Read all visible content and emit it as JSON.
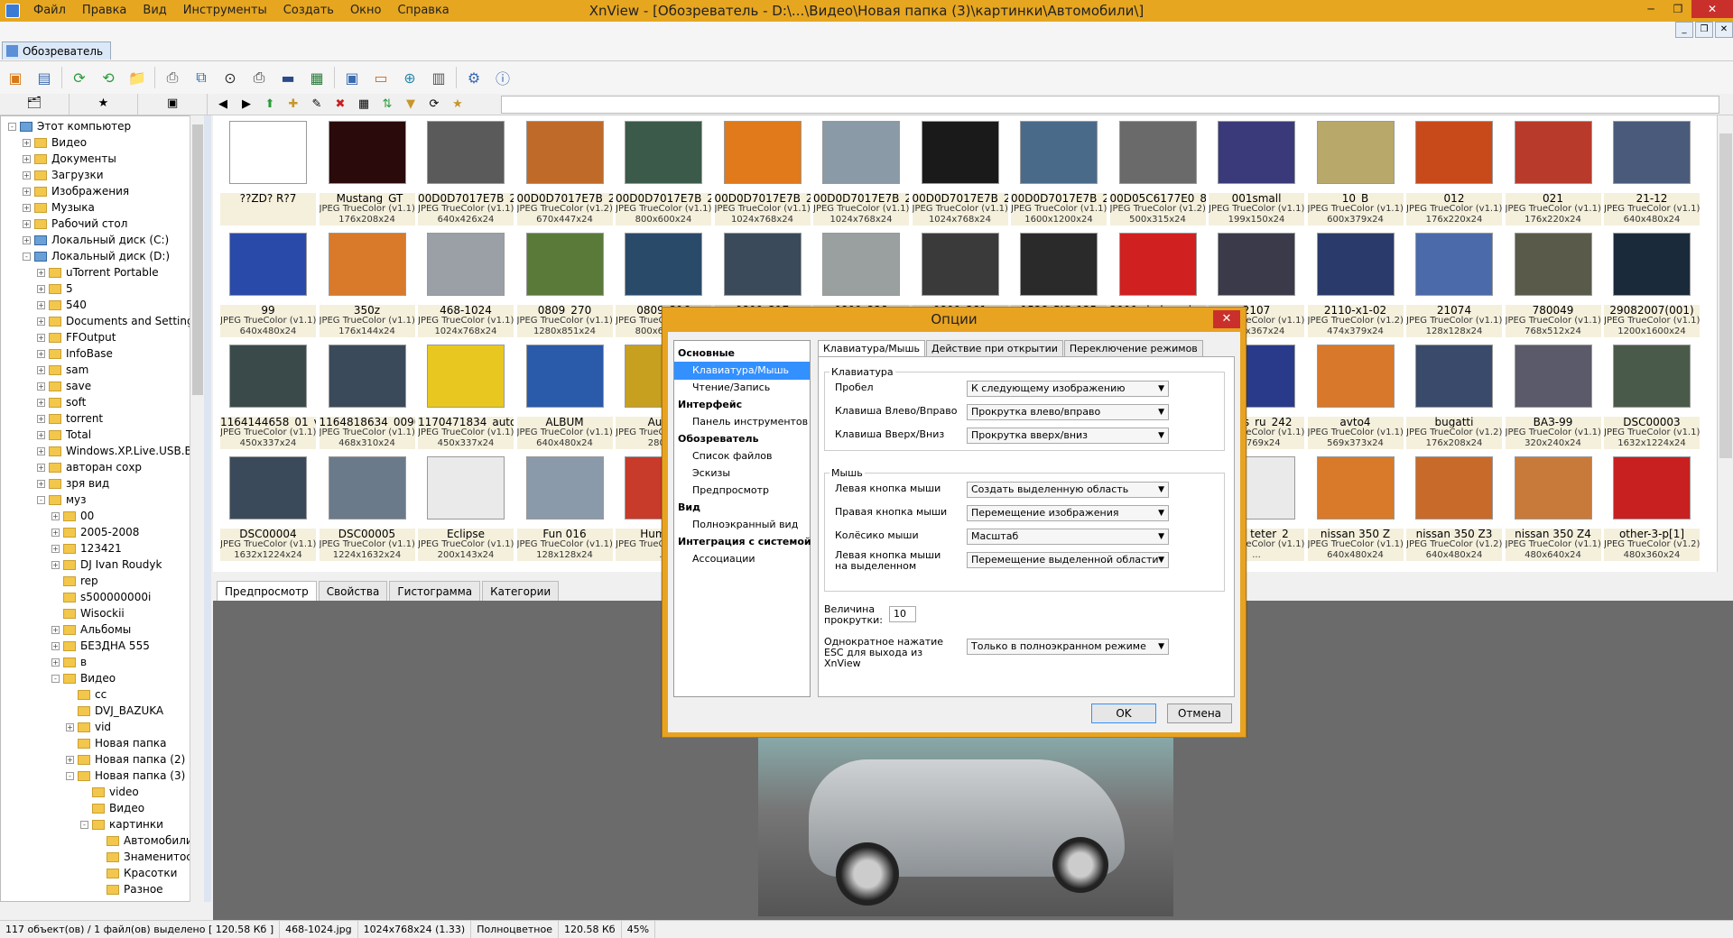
{
  "window": {
    "title": "XnView - [Обозреватель - D:\\...\\Видео\\Новая папка (3)\\картинки\\Автомобили\\]",
    "menu": [
      "Файл",
      "Правка",
      "Вид",
      "Инструменты",
      "Создать",
      "Окно",
      "Справка"
    ],
    "doc_tab": "Обозреватель"
  },
  "tree": {
    "items": [
      {
        "label": "Этот компьютер",
        "level": 0,
        "type": "pc",
        "exp": "-"
      },
      {
        "label": "Видео",
        "level": 1,
        "type": "folder",
        "exp": "+"
      },
      {
        "label": "Документы",
        "level": 1,
        "type": "folder",
        "exp": "+"
      },
      {
        "label": "Загрузки",
        "level": 1,
        "type": "folder",
        "exp": "+"
      },
      {
        "label": "Изображения",
        "level": 1,
        "type": "folder",
        "exp": "+"
      },
      {
        "label": "Музыка",
        "level": 1,
        "type": "folder",
        "exp": "+"
      },
      {
        "label": "Рабочий стол",
        "level": 1,
        "type": "folder",
        "exp": "+"
      },
      {
        "label": "Локальный диск (C:)",
        "level": 1,
        "type": "pc",
        "exp": "+"
      },
      {
        "label": "Локальный диск (D:)",
        "level": 1,
        "type": "pc",
        "exp": "-"
      },
      {
        "label": "uTorrent Portable",
        "level": 2,
        "type": "folder",
        "exp": "+"
      },
      {
        "label": "5",
        "level": 2,
        "type": "folder",
        "exp": "+"
      },
      {
        "label": "540",
        "level": 2,
        "type": "folder",
        "exp": "+"
      },
      {
        "label": "Documents and Settings",
        "level": 2,
        "type": "folder",
        "exp": "+"
      },
      {
        "label": "FFOutput",
        "level": 2,
        "type": "folder",
        "exp": "+"
      },
      {
        "label": "InfoBase",
        "level": 2,
        "type": "folder",
        "exp": "+"
      },
      {
        "label": "sam",
        "level": 2,
        "type": "folder",
        "exp": "+"
      },
      {
        "label": "save",
        "level": 2,
        "type": "folder",
        "exp": "+"
      },
      {
        "label": "soft",
        "level": 2,
        "type": "folder",
        "exp": "+"
      },
      {
        "label": "torrent",
        "level": 2,
        "type": "folder",
        "exp": "+"
      },
      {
        "label": "Total",
        "level": 2,
        "type": "folder",
        "exp": "+"
      },
      {
        "label": "Windows.XP.Live.USB.BI",
        "level": 2,
        "type": "folder",
        "exp": "+"
      },
      {
        "label": "авторан сохр",
        "level": 2,
        "type": "folder",
        "exp": "+"
      },
      {
        "label": "зря вид",
        "level": 2,
        "type": "folder",
        "exp": "+"
      },
      {
        "label": "муз",
        "level": 2,
        "type": "folder",
        "exp": "-"
      },
      {
        "label": "00",
        "level": 3,
        "type": "folder",
        "exp": "+"
      },
      {
        "label": "2005-2008",
        "level": 3,
        "type": "folder",
        "exp": "+"
      },
      {
        "label": "123421",
        "level": 3,
        "type": "folder",
        "exp": "+"
      },
      {
        "label": "DJ Ivan Roudyk",
        "level": 3,
        "type": "folder",
        "exp": "+"
      },
      {
        "label": "rep",
        "level": 3,
        "type": "folder",
        "exp": ""
      },
      {
        "label": "s500000000i",
        "level": 3,
        "type": "folder",
        "exp": ""
      },
      {
        "label": "Wisockii",
        "level": 3,
        "type": "folder",
        "exp": ""
      },
      {
        "label": "Альбомы",
        "level": 3,
        "type": "folder",
        "exp": "+"
      },
      {
        "label": "БЕЗДНА 555",
        "level": 3,
        "type": "folder",
        "exp": "+"
      },
      {
        "label": "в",
        "level": 3,
        "type": "folder",
        "exp": "+"
      },
      {
        "label": "Видео",
        "level": 3,
        "type": "folder",
        "exp": "-"
      },
      {
        "label": "cc",
        "level": 4,
        "type": "folder",
        "exp": ""
      },
      {
        "label": "DVJ_BAZUKA",
        "level": 4,
        "type": "folder",
        "exp": ""
      },
      {
        "label": "vid",
        "level": 4,
        "type": "folder",
        "exp": "+"
      },
      {
        "label": "Новая папка",
        "level": 4,
        "type": "folder",
        "exp": ""
      },
      {
        "label": "Новая папка (2)",
        "level": 4,
        "type": "folder",
        "exp": "+"
      },
      {
        "label": "Новая папка (3)",
        "level": 4,
        "type": "folder",
        "exp": "-"
      },
      {
        "label": "video",
        "level": 5,
        "type": "folder",
        "exp": ""
      },
      {
        "label": "Видео",
        "level": 5,
        "type": "folder",
        "exp": ""
      },
      {
        "label": "картинки",
        "level": 5,
        "type": "folder",
        "exp": "-"
      },
      {
        "label": "Автомобили",
        "level": 6,
        "type": "folder",
        "exp": ""
      },
      {
        "label": "Знаменитости",
        "level": 6,
        "type": "folder",
        "exp": ""
      },
      {
        "label": "Красотки",
        "level": 6,
        "type": "folder",
        "exp": ""
      },
      {
        "label": "Разное",
        "level": 6,
        "type": "folder",
        "exp": ""
      }
    ]
  },
  "thumbs": [
    [
      {
        "name": "??ZD? R?7",
        "type": "",
        "dims": "",
        "color": "#ffffff"
      },
      {
        "name": "_Mustang_GT",
        "type": "JPEG TrueColor (v1.1)",
        "dims": "176x208x24",
        "color": "#2a0a0a"
      },
      {
        "name": "00D0D7017E7B_2...",
        "type": "JPEG TrueColor (v1.1)",
        "dims": "640x426x24",
        "color": "#5a5a5a"
      },
      {
        "name": "00D0D7017E7B_2...",
        "type": "JPEG TrueColor (v1.2)",
        "dims": "670x447x24",
        "color": "#c06a2a"
      },
      {
        "name": "00D0D7017E7B_2...",
        "type": "JPEG TrueColor (v1.1)",
        "dims": "800x600x24",
        "color": "#3c5a4a"
      },
      {
        "name": "00D0D7017E7B_2...",
        "type": "JPEG TrueColor (v1.1)",
        "dims": "1024x768x24",
        "color": "#e07a1a"
      },
      {
        "name": "00D0D7017E7B_2...",
        "type": "JPEG TrueColor (v1.1)",
        "dims": "1024x768x24",
        "color": "#8a9aa6"
      },
      {
        "name": "00D0D7017E7B_2...",
        "type": "JPEG TrueColor (v1.1)",
        "dims": "1024x768x24",
        "color": "#1a1a1a"
      },
      {
        "name": "00D0D7017E7B_2...",
        "type": "JPEG TrueColor (v1.1)",
        "dims": "1600x1200x24",
        "color": "#4a6a8a"
      },
      {
        "name": "00D05C6177E0_8...",
        "type": "JPEG TrueColor (v1.2)",
        "dims": "500x315x24",
        "color": "#6a6a6a"
      },
      {
        "name": "001small",
        "type": "JPEG TrueColor (v1.1)",
        "dims": "199x150x24",
        "color": "#3a3a7a"
      },
      {
        "name": "10_B",
        "type": "JPEG TrueColor (v1.1)",
        "dims": "600x379x24",
        "color": "#b8a86a"
      },
      {
        "name": "012",
        "type": "JPEG TrueColor (v1.1)",
        "dims": "176x220x24",
        "color": "#c84a1a"
      },
      {
        "name": "021",
        "type": "JPEG TrueColor (v1.1)",
        "dims": "176x220x24",
        "color": "#b83a2a"
      },
      {
        "name": "21-12",
        "type": "JPEG TrueColor (v1.1)",
        "dims": "640x480x24",
        "color": "#4a5a7a"
      }
    ],
    [
      {
        "name": "99",
        "type": "JPEG TrueColor (v1.1)",
        "dims": "640x480x24",
        "color": "#2a4aaa"
      },
      {
        "name": "350z",
        "type": "JPEG TrueColor (v1.1)",
        "dims": "176x144x24",
        "color": "#d87a2a"
      },
      {
        "name": "468-1024",
        "type": "JPEG TrueColor (v1.1)",
        "dims": "1024x768x24",
        "color": "#9aa0a6"
      },
      {
        "name": "0809_270",
        "type": "JPEG TrueColor (v1.1)",
        "dims": "1280x851x24",
        "color": "#5a7a3a"
      },
      {
        "name": "0809_316",
        "type": "JPEG TrueColor (v1.1)",
        "dims": "800x600x24",
        "color": "#2a4a6a"
      },
      {
        "name": "0809_317",
        "type": "JPEG TrueColor (v1.1)",
        "dims": "",
        "color": "#3a4a5a"
      },
      {
        "name": "0809_328",
        "type": "JPEG TrueColor (v1.1)",
        "dims": "",
        "color": "#9aa0a0"
      },
      {
        "name": "0809_381",
        "type": "JPEG TrueColor (v1.1)",
        "dims": "",
        "color": "#3a3a3a"
      },
      {
        "name": "1528_PIC_125",
        "type": "JPEG TrueColor (v1.1)",
        "dims": "",
        "color": "#2a2a2a"
      },
      {
        "name": "2000_dodge_vip...",
        "type": "JPEG TrueColor (v1.1)",
        "dims": "",
        "color": "#d02020"
      },
      {
        "name": "2107",
        "type": "JPEG TrueColor (v1.1)",
        "dims": "400x367x24",
        "color": "#3a3a4a"
      },
      {
        "name": "2110-x1-02",
        "type": "JPEG TrueColor (v1.2)",
        "dims": "474x379x24",
        "color": "#2a3a6a"
      },
      {
        "name": "21074",
        "type": "JPEG TrueColor (v1.1)",
        "dims": "128x128x24",
        "color": "#4a6aaa"
      },
      {
        "name": "780049",
        "type": "JPEG TrueColor (v1.1)",
        "dims": "768x512x24",
        "color": "#5a5a4a"
      },
      {
        "name": "29082007(001)",
        "type": "JPEG TrueColor (v1.1)",
        "dims": "1200x1600x24",
        "color": "#1a2a3a"
      }
    ],
    [
      {
        "name": "1164144658_01_v...",
        "type": "JPEG TrueColor (v1.1)",
        "dims": "450x337x24",
        "color": "#3a4a4a"
      },
      {
        "name": "1164818634_0090...",
        "type": "JPEG TrueColor (v1.1)",
        "dims": "468x310x24",
        "color": "#3a4a5a"
      },
      {
        "name": "1170471834_auto...",
        "type": "JPEG TrueColor (v1.1)",
        "dims": "450x337x24",
        "color": "#e8c820"
      },
      {
        "name": "ALBUM",
        "type": "JPEG TrueColor (v1.1)",
        "dims": "640x480x24",
        "color": "#2a5aaa"
      },
      {
        "name": "Aud...",
        "type": "JPEG TrueColor (v1.1)",
        "dims": "280x...",
        "color": "#c8a020"
      },
      {
        "name": "",
        "type": "",
        "dims": "",
        "color": "#ffffff"
      },
      {
        "name": "",
        "type": "",
        "dims": "",
        "color": "#ffffff"
      },
      {
        "name": "",
        "type": "",
        "dims": "",
        "color": "#ffffff"
      },
      {
        "name": "",
        "type": "",
        "dims": "",
        "color": "#ffffff"
      },
      {
        "name": "",
        "type": "",
        "dims": "",
        "color": "#ffffff"
      },
      {
        "name": "...alls_ru_242",
        "type": "JPEG TrueColor (v1.1)",
        "dims": "...x769x24",
        "color": "#2a3a8a"
      },
      {
        "name": "avto4",
        "type": "JPEG TrueColor (v1.1)",
        "dims": "569x373x24",
        "color": "#d8782a"
      },
      {
        "name": "bugatti",
        "type": "JPEG TrueColor (v1.2)",
        "dims": "176x208x24",
        "color": "#3a4a6a"
      },
      {
        "name": "ВАЗ-99",
        "type": "JPEG TrueColor (v1.1)",
        "dims": "320x240x24",
        "color": "#5a5a6a"
      },
      {
        "name": "DSC00003",
        "type": "JPEG TrueColor (v1.1)",
        "dims": "1632x1224x24",
        "color": "#4a5a4a"
      }
    ],
    [
      {
        "name": "DSC00004",
        "type": "JPEG TrueColor (v1.1)",
        "dims": "1632x1224x24",
        "color": "#3a4a5a"
      },
      {
        "name": "DSC00005",
        "type": "JPEG TrueColor (v1.1)",
        "dims": "1224x1632x24",
        "color": "#6a7a8a"
      },
      {
        "name": "Eclipse",
        "type": "JPEG TrueColor (v1.1)",
        "dims": "200x143x24",
        "color": "#eaeaea"
      },
      {
        "name": "Fun 016",
        "type": "JPEG TrueColor (v1.1)",
        "dims": "128x128x24",
        "color": "#8a9aaa"
      },
      {
        "name": "Humm...",
        "type": "JPEG TrueColor (v1.1)",
        "dims": "...",
        "color": "#c83a2a"
      },
      {
        "name": "",
        "type": "",
        "dims": "",
        "color": "#ffffff"
      },
      {
        "name": "",
        "type": "",
        "dims": "",
        "color": "#ffffff"
      },
      {
        "name": "",
        "type": "",
        "dims": "",
        "color": "#ffffff"
      },
      {
        "name": "",
        "type": "",
        "dims": "",
        "color": "#ffffff"
      },
      {
        "name": "",
        "type": "",
        "dims": "",
        "color": "#ffffff"
      },
      {
        "name": "112_teter_2",
        "type": "JPEG TrueColor (v1.1)",
        "dims": "...",
        "color": "#eaeaea"
      },
      {
        "name": "nissan 350 Z",
        "type": "JPEG TrueColor (v1.1)",
        "dims": "640x480x24",
        "color": "#d87a2a"
      },
      {
        "name": "nissan 350 Z3",
        "type": "JPEG TrueColor (v1.2)",
        "dims": "640x480x24",
        "color": "#c86a2a"
      },
      {
        "name": "nissan 350 Z4",
        "type": "JPEG TrueColor (v1.1)",
        "dims": "480x640x24",
        "color": "#c87a3a"
      },
      {
        "name": "other-3-p[1]",
        "type": "JPEG TrueColor (v1.2)",
        "dims": "480x360x24",
        "color": "#c82020"
      }
    ]
  ],
  "bottom_tabs": [
    "Предпросмотр",
    "Свойства",
    "Гистограмма",
    "Категории"
  ],
  "status": [
    "117 объект(ов) / 1 файл(ов) выделено  [ 120.58 Кб ]",
    "468-1024.jpg",
    "1024x768x24 (1.33)",
    "Полноцветное",
    "120.58 Кб",
    "45%"
  ],
  "dialog": {
    "title": "Опции",
    "close": "✕",
    "nav": [
      {
        "label": "Основные",
        "kind": "h"
      },
      {
        "label": "Клавиатура/Мышь",
        "kind": "s",
        "selected": true
      },
      {
        "label": "Чтение/Запись",
        "kind": "s"
      },
      {
        "label": "Интерфейс",
        "kind": "h"
      },
      {
        "label": "Панель инструментов",
        "kind": "s"
      },
      {
        "label": "Обозреватель",
        "kind": "h"
      },
      {
        "label": "Список файлов",
        "kind": "s"
      },
      {
        "label": "Эскизы",
        "kind": "s"
      },
      {
        "label": "Предпросмотр",
        "kind": "s"
      },
      {
        "label": "Вид",
        "kind": "h"
      },
      {
        "label": "Полноэкранный вид",
        "kind": "s"
      },
      {
        "label": "Интеграция с системой",
        "kind": "h"
      },
      {
        "label": "Ассоциации",
        "kind": "s"
      }
    ],
    "tabs": [
      "Клавиатура/Мышь",
      "Действие при открытии",
      "Переключение режимов"
    ],
    "keyboard_group": "Клавиатура",
    "keyboard": [
      {
        "label": "Пробел",
        "value": "К следующему изображению"
      },
      {
        "label": "Клавиша Влево/Вправо",
        "value": "Прокрутка влево/вправо"
      },
      {
        "label": "Клавиша Вверх/Вниз",
        "value": "Прокрутка вверх/вниз"
      }
    ],
    "mouse_group": "Мышь",
    "mouse": [
      {
        "label": "Левая кнопка мыши",
        "value": "Создать выделенную область"
      },
      {
        "label": "Правая кнопка мыши",
        "value": "Перемещение изображения"
      },
      {
        "label": "Колёсико мыши",
        "value": "Масштаб"
      },
      {
        "label": "Левая кнопка мыши на выделенном",
        "value": "Перемещение выделенной области"
      }
    ],
    "scroll_label": "Величина прокрутки:",
    "scroll_value": "10",
    "esc_label": "Однократное нажатие ESC для выхода из XnView",
    "esc_value": "Только в полноэкранном режиме",
    "ok": "OK",
    "cancel": "Отмена"
  }
}
